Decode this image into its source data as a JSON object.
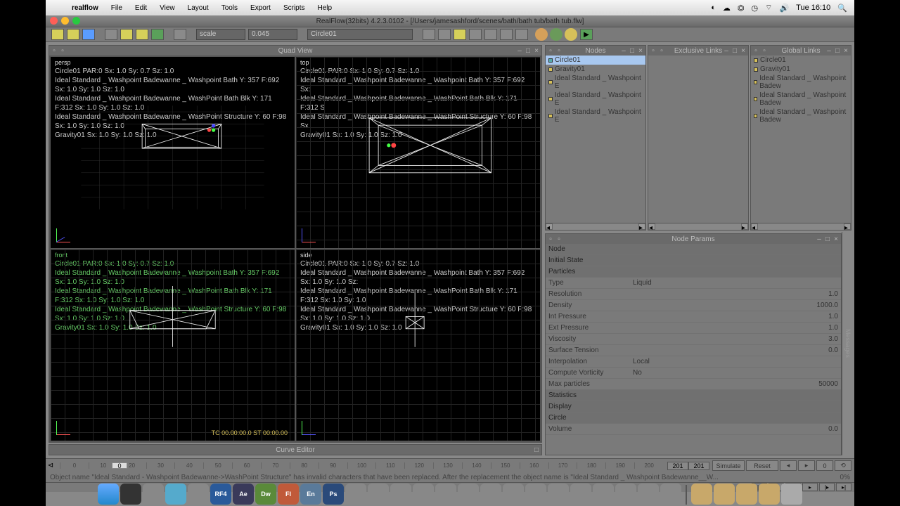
{
  "menubar": {
    "app": "realflow",
    "items": [
      "File",
      "Edit",
      "View",
      "Layout",
      "Tools",
      "Export",
      "Scripts",
      "Help"
    ],
    "clock": "Tue 16:10"
  },
  "window": {
    "title": "RealFlow(32bits) 4.2.3.0102 - [/Users/jamesashford/scenes/bath/bath tub/bath tub.flw]"
  },
  "toolbar": {
    "scale_label": "scale",
    "scale_value": "0.045",
    "object_field": "Circle01"
  },
  "quadview": {
    "title": "Quad View",
    "persp": {
      "name": "persp",
      "lines": [
        "Circle01 PAR:0 Sx: 1.0 Sy: 0.7 Sz: 1.0",
        "Ideal Standard _ Washpoint Badewanne _ Washpoint Bath Y: 357 F:692 Sx: 1.0 Sy: 1.0 Sz: 1.0",
        "Ideal Standard _ Washpoint Badewanne _ WashPoint Bath Blk Y: 171 F:312 Sx: 1.0 Sy: 1.0 Sz: 1.0",
        "Ideal Standard _ Washpoint Badewanne _ WashPoint Structure Y: 60 F:98 Sx: 1.0 Sy: 1.0 Sz: 1.0",
        "Gravity01 Sx: 1.0 Sy: 1.0 Sz: 1.0"
      ]
    },
    "top": {
      "name": "top",
      "lines": [
        "Circle01 PAR:0 Sx: 1.0 Sy: 0.7 Sz: 1.0",
        "Ideal Standard _ Washpoint Badewanne _ Washpoint Bath Y: 357 F:692 Sx:",
        "Ideal Standard _ Washpoint Badewanne _ WashPoint Bath Blk Y: 171 F:312 S",
        "Ideal Standard _ Washpoint Badewanne _ WashPoint Structure Y: 60 F:98 Sx",
        "Gravity01 Sx: 1.0 Sy: 1.0 Sz: 1.0"
      ]
    },
    "front": {
      "name": "front",
      "lines": [
        "Circle01 PAR:0 Sx: 1.0 Sy: 0.7 Sz: 1.0",
        "Ideal Standard _ Washpoint Badewanne _ Washpoint Bath Y: 357 F:692 Sx: 1.0 Sy: 1.0 Sz: 1.0",
        "Ideal Standard _ Washpoint Badewanne _ WashPoint Bath Blk Y: 171 F:312 Sx: 1.0 Sy: 1.0 Sz: 1.0",
        "Ideal Standard _ Washpoint Badewanne _ WashPoint Structure Y: 60 F:98 Sx: 1.0 Sy: 1.0 Sz: 1.0",
        "Gravity01 Sx: 1.0 Sy: 1.0 Sz: 1.0"
      ],
      "tc": "TC 00.00:00.0  ST 00:00.00"
    },
    "side": {
      "name": "side",
      "lines": [
        "Circle01 PAR:0 Sx: 1.0 Sy: 0.7 Sz: 1.0",
        "Ideal Standard _ Washpoint Badewanne _ Washpoint Bath Y: 357 F:692 Sx: 1.0 Sy: 1.0 Sz:",
        "Ideal Standard _ Washpoint Badewanne _ WashPoint Bath Blk Y: 171 F:312 Sx: 1.0 Sy: 1.0",
        "Ideal Standard _ Washpoint Badewanne _ WashPoint Structure Y: 60 F:98 Sx: 1.0 Sy: 1.0 Sz: 1.0",
        "Gravity01 Sx: 1.0 Sy: 1.0 Sz: 1.0"
      ]
    }
  },
  "curve_editor": {
    "title": "Curve Editor"
  },
  "nodes": {
    "title": "Nodes",
    "items": [
      {
        "name": "Circle01",
        "selected": true,
        "dot": "b"
      },
      {
        "name": "Gravity01"
      },
      {
        "name": "Ideal Standard _ Washpoint E"
      },
      {
        "name": "Ideal Standard _ Washpoint E"
      },
      {
        "name": "Ideal Standard _ Washpoint E"
      }
    ]
  },
  "exclusive_links": {
    "title": "Exclusive Links"
  },
  "global_links": {
    "title": "Global Links",
    "items": [
      {
        "name": "Circle01"
      },
      {
        "name": "Gravity01"
      },
      {
        "name": "Ideal Standard _ Washpoint Badew"
      },
      {
        "name": "Ideal Standard _ Washpoint Badew"
      },
      {
        "name": "Ideal Standard _ Washpoint Badew"
      }
    ]
  },
  "node_params": {
    "title": "Node Params",
    "sections": [
      {
        "k": "Node",
        "hdr": true
      },
      {
        "k": "Initial State",
        "hdr": true
      },
      {
        "k": "Particles",
        "hdr": true
      },
      {
        "k": "Type",
        "v": "Liquid",
        "left": true
      },
      {
        "k": "Resolution",
        "v": "1.0"
      },
      {
        "k": "Density",
        "v": "1000.0"
      },
      {
        "k": "Int Pressure",
        "v": "1.0"
      },
      {
        "k": "Ext Pressure",
        "v": "1.0"
      },
      {
        "k": "Viscosity",
        "v": "3.0"
      },
      {
        "k": "Surface Tension",
        "v": "0.0"
      },
      {
        "k": "Interpolation",
        "v": "Local",
        "left": true
      },
      {
        "k": "Compute Vorticity",
        "v": "No",
        "left": true
      },
      {
        "k": "Max particles",
        "v": "50000"
      },
      {
        "k": "Statistics",
        "hdr": true
      },
      {
        "k": "Display",
        "hdr": true
      },
      {
        "k": "Circle",
        "hdr": true
      },
      {
        "k": "Volume",
        "v": "0.0"
      }
    ]
  },
  "messages_tab": "Messages",
  "timeline": {
    "ticks": [
      "0",
      "10",
      "20",
      "30",
      "40",
      "50",
      "60",
      "70",
      "80",
      "90",
      "100",
      "110",
      "120",
      "130",
      "140",
      "150",
      "160",
      "170",
      "180",
      "190",
      "200"
    ],
    "current": "0",
    "end1": "201",
    "end2": "201",
    "simulate": "Simulate",
    "reset": "Reset",
    "frame_field": "0"
  },
  "status": {
    "text": "Object name \"Ideal Standard - Washpoint Badewanne->WashPoint Structure\" has invalid characters that have been replaced. After the replacement the object name is \"Ideal Standard _ Washpoint Badewanne__W...",
    "pct": "0%"
  },
  "dock": {
    "icons": [
      "",
      "",
      "RF4",
      "",
      "",
      "Ae",
      "Dw",
      "Fl",
      "En",
      "Ps",
      "",
      "",
      "",
      "",
      "",
      "",
      "",
      "",
      "",
      "",
      "",
      "",
      "",
      "",
      "",
      ""
    ]
  }
}
